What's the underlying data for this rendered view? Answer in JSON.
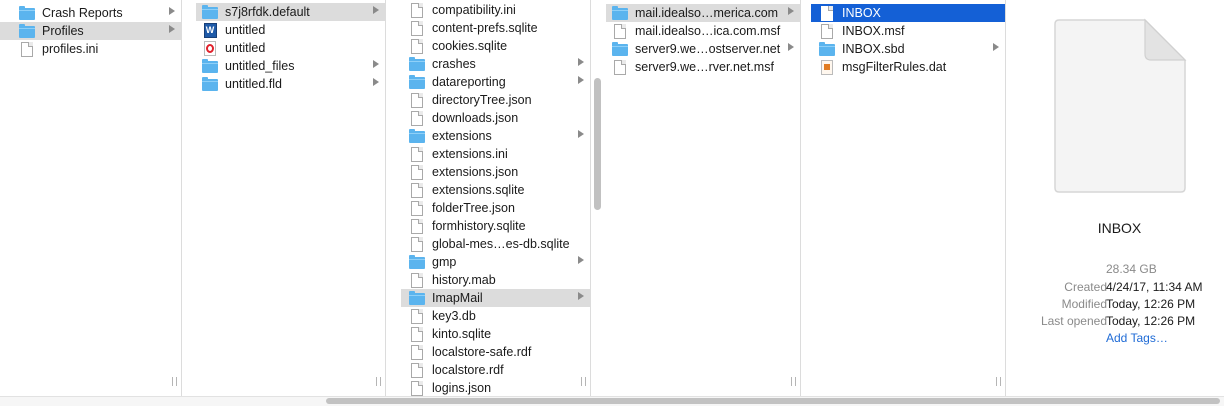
{
  "columns": [
    {
      "items": [
        {
          "label": "Crash Reports",
          "icon": "folder-icon",
          "chevron": true,
          "state": "normal"
        },
        {
          "label": "Profiles",
          "icon": "folder-icon",
          "chevron": true,
          "state": "selected-inactive"
        },
        {
          "label": "profiles.ini",
          "icon": "document-icon",
          "chevron": false,
          "state": "normal"
        }
      ]
    },
    {
      "items": [
        {
          "label": "s7j8rfdk.default",
          "icon": "folder-icon",
          "chevron": true,
          "state": "selected-inactive"
        },
        {
          "label": "untitled",
          "icon": "word-document-icon",
          "chevron": false,
          "state": "normal"
        },
        {
          "label": "untitled",
          "icon": "opera-document-icon",
          "chevron": false,
          "state": "normal"
        },
        {
          "label": "untitled_files",
          "icon": "folder-icon",
          "chevron": true,
          "state": "normal"
        },
        {
          "label": "untitled.fld",
          "icon": "folder-icon",
          "chevron": true,
          "state": "normal"
        }
      ]
    },
    {
      "items": [
        {
          "label": "compatibility.ini",
          "icon": "document-icon",
          "chevron": false,
          "state": "normal"
        },
        {
          "label": "content-prefs.sqlite",
          "icon": "document-icon",
          "chevron": false,
          "state": "normal"
        },
        {
          "label": "cookies.sqlite",
          "icon": "document-icon",
          "chevron": false,
          "state": "normal"
        },
        {
          "label": "crashes",
          "icon": "folder-icon",
          "chevron": true,
          "state": "normal"
        },
        {
          "label": "datareporting",
          "icon": "folder-icon",
          "chevron": true,
          "state": "normal"
        },
        {
          "label": "directoryTree.json",
          "icon": "document-icon",
          "chevron": false,
          "state": "normal"
        },
        {
          "label": "downloads.json",
          "icon": "document-icon",
          "chevron": false,
          "state": "normal"
        },
        {
          "label": "extensions",
          "icon": "folder-icon",
          "chevron": true,
          "state": "normal"
        },
        {
          "label": "extensions.ini",
          "icon": "document-icon",
          "chevron": false,
          "state": "normal"
        },
        {
          "label": "extensions.json",
          "icon": "document-icon",
          "chevron": false,
          "state": "normal"
        },
        {
          "label": "extensions.sqlite",
          "icon": "document-icon",
          "chevron": false,
          "state": "normal"
        },
        {
          "label": "folderTree.json",
          "icon": "document-icon",
          "chevron": false,
          "state": "normal"
        },
        {
          "label": "formhistory.sqlite",
          "icon": "document-icon",
          "chevron": false,
          "state": "normal"
        },
        {
          "label": "global-mes…es-db.sqlite",
          "icon": "document-icon",
          "chevron": false,
          "state": "normal"
        },
        {
          "label": "gmp",
          "icon": "folder-icon",
          "chevron": true,
          "state": "normal"
        },
        {
          "label": "history.mab",
          "icon": "document-icon",
          "chevron": false,
          "state": "normal"
        },
        {
          "label": "ImapMail",
          "icon": "folder-icon",
          "chevron": true,
          "state": "selected-inactive"
        },
        {
          "label": "key3.db",
          "icon": "document-icon",
          "chevron": false,
          "state": "normal"
        },
        {
          "label": "kinto.sqlite",
          "icon": "document-icon",
          "chevron": false,
          "state": "normal"
        },
        {
          "label": "localstore-safe.rdf",
          "icon": "document-icon",
          "chevron": false,
          "state": "normal"
        },
        {
          "label": "localstore.rdf",
          "icon": "document-icon",
          "chevron": false,
          "state": "normal"
        },
        {
          "label": "logins.json",
          "icon": "document-icon",
          "chevron": false,
          "state": "normal"
        }
      ]
    },
    {
      "items": [
        {
          "label": "mail.idealso…merica.com",
          "icon": "folder-icon",
          "chevron": true,
          "state": "selected-inactive"
        },
        {
          "label": "mail.idealso…ica.com.msf",
          "icon": "document-icon",
          "chevron": false,
          "state": "normal"
        },
        {
          "label": "server9.we…ostserver.net",
          "icon": "folder-icon",
          "chevron": true,
          "state": "normal"
        },
        {
          "label": "server9.we…rver.net.msf",
          "icon": "document-icon",
          "chevron": false,
          "state": "normal"
        }
      ]
    },
    {
      "items": [
        {
          "label": "INBOX",
          "icon": "document-icon",
          "chevron": false,
          "state": "selected-active"
        },
        {
          "label": "INBOX.msf",
          "icon": "document-icon",
          "chevron": false,
          "state": "normal"
        },
        {
          "label": "INBOX.sbd",
          "icon": "folder-icon",
          "chevron": true,
          "state": "normal"
        },
        {
          "label": "msgFilterRules.dat",
          "icon": "rules-document-icon",
          "chevron": false,
          "state": "normal"
        }
      ]
    }
  ],
  "preview": {
    "title": "INBOX",
    "size": "28.34 GB",
    "created_label": "Created",
    "created_value": "4/24/17, 11:34 AM",
    "modified_label": "Modified",
    "modified_value": "Today, 12:26 PM",
    "opened_label": "Last opened",
    "opened_value": "Today, 12:26 PM",
    "add_tags": "Add Tags…"
  },
  "colors": {
    "folder": "#5bb4ee",
    "selection_active": "#1460d6",
    "selection_inactive": "#dcdcdc",
    "link": "#1f6bd6"
  }
}
